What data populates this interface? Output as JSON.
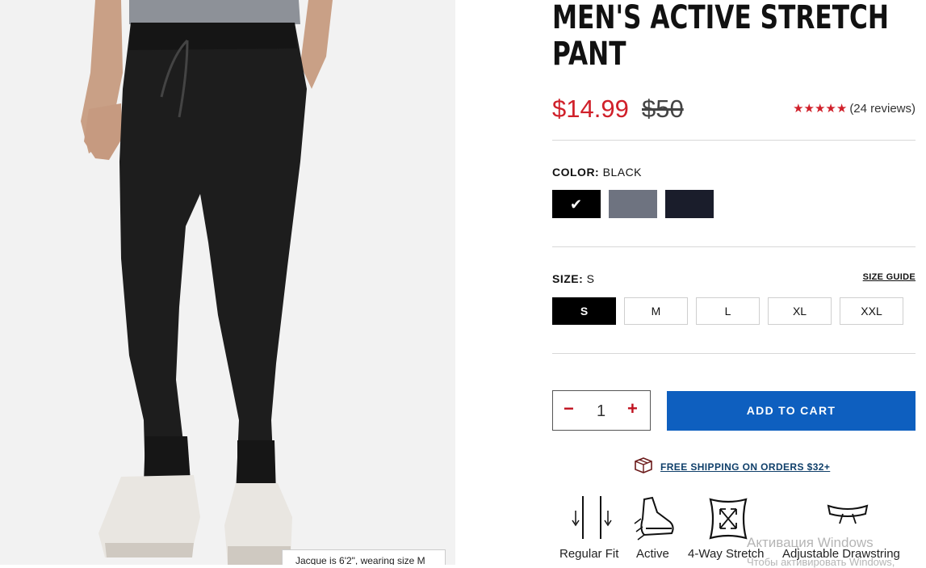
{
  "product": {
    "title": "MEN'S ACTIVE STRETCH PANT",
    "price_sale": "$14.99",
    "price_original": "$50",
    "stars": "★★★★★",
    "reviews": "(24 reviews)",
    "image_caption": "Jacque is 6'2\", wearing size M"
  },
  "color": {
    "label": "COLOR:",
    "selected": "BLACK",
    "swatches": [
      {
        "name": "black",
        "hex": "#000000",
        "selected": true
      },
      {
        "name": "grey",
        "hex": "#6e7380",
        "selected": false
      },
      {
        "name": "navy",
        "hex": "#1a1d2b",
        "selected": false
      }
    ],
    "check_glyph": "✔"
  },
  "size": {
    "label": "SIZE:",
    "selected": "S",
    "guide_label": "SIZE GUIDE",
    "options": [
      "S",
      "M",
      "L",
      "XL",
      "XXL"
    ]
  },
  "cart": {
    "minus": "−",
    "quantity": "1",
    "plus": "+",
    "add_label": "ADD TO CART"
  },
  "shipping": {
    "text": "FREE SHIPPING ON ORDERS $32+",
    "icon": "box-icon"
  },
  "features": [
    {
      "label": "Regular Fit",
      "icon": "regular-fit-icon"
    },
    {
      "label": "Active",
      "icon": "running-shoe-icon"
    },
    {
      "label": "4-Way Stretch",
      "icon": "four-way-stretch-icon"
    },
    {
      "label": "Adjustable Drawstring",
      "icon": "drawstring-icon"
    }
  ],
  "watermark": {
    "line1": "Активация Windows",
    "line2": "Чтобы активировать Windows,"
  },
  "colors": {
    "sale_red": "#d0202a",
    "cart_blue": "#0e5fbf",
    "shipping_blue": "#0f3f6a"
  }
}
